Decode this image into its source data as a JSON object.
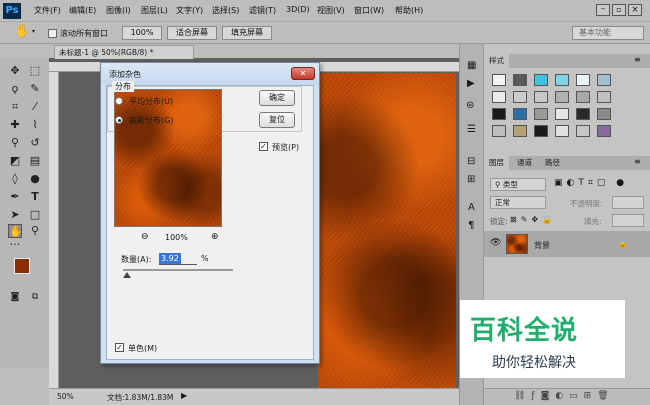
{
  "app": {
    "logo": "Ps",
    "menus": [
      "文件(F)",
      "编辑(E)",
      "图像(I)",
      "图层(L)",
      "文字(Y)",
      "选择(S)",
      "滤镜(T)",
      "3D(D)",
      "视图(V)",
      "窗口(W)",
      "帮助(H)"
    ]
  },
  "options_bar": {
    "scroll_all_label": "滚动所有窗口",
    "zoom_100_label": "100%",
    "fit_screen_label": "适合屏幕",
    "fill_screen_label": "填充屏幕",
    "workspace_label": "基本功能"
  },
  "document": {
    "tab_label": "未标题-1 @ 50%(RGB/8) *",
    "zoom": "50%",
    "status": "文档:1.83M/1.83M"
  },
  "dialog": {
    "title": "添加杂色",
    "ok_label": "确定",
    "reset_label": "复位",
    "preview_label": "预览(P)",
    "preview_checked": true,
    "preview_zoom": "100%",
    "amount_label": "数量(A):",
    "amount_value": "3.92",
    "amount_unit": "%",
    "amount_fraction": 0.04,
    "distribution_title": "分布",
    "uniform_label": "平均分布(U)",
    "gaussian_label": "高斯分布(G)",
    "selected_distribution": "gaussian",
    "monochrome_label": "单色(M)",
    "monochrome_checked": true
  },
  "panels": {
    "styles_tab": "样式",
    "layers_tabs": [
      "图层",
      "通道",
      "路径"
    ],
    "kind_label": "类型",
    "blend_mode": "正常",
    "opacity_label": "不透明度:",
    "lock_label": "锁定:",
    "fill_label": "填充:",
    "layer_name": "背景"
  },
  "watermark": {
    "title": "百科全说",
    "subtitle": "助你轻松解决"
  },
  "colors": {
    "noise_base": "#c04a08",
    "foreground": "#8b2d05",
    "background": "#1a1a1a",
    "watermark_green": "#1fae6b"
  }
}
